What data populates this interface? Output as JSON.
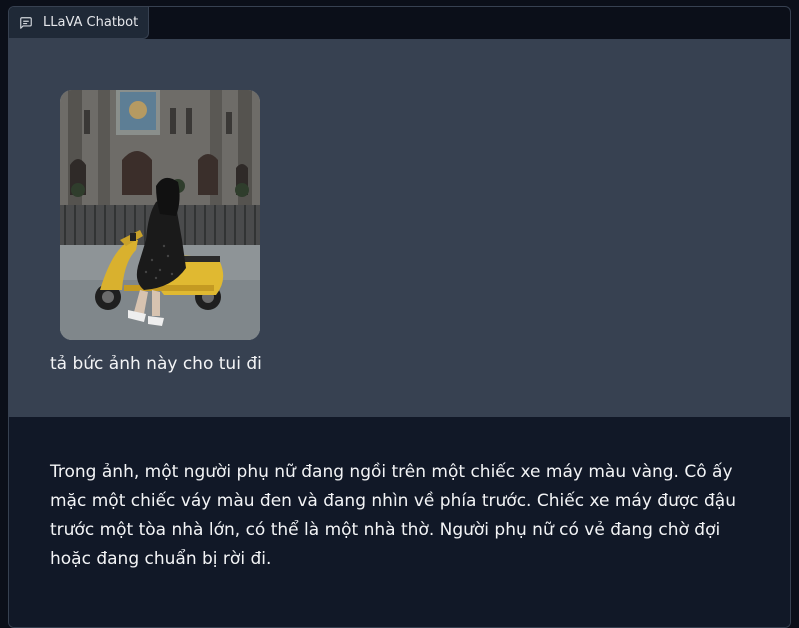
{
  "header": {
    "title": "LLaVA Chatbot",
    "icon": "chat-icon"
  },
  "messages": [
    {
      "role": "user",
      "image": "photo of a woman in a black dress sitting on a yellow scooter in front of a gothic cathedral",
      "text": "tả bức ảnh này cho tui đi"
    },
    {
      "role": "bot",
      "text": "Trong ảnh, một người phụ nữ đang ngồi trên một chiếc xe máy màu vàng. Cô ấy mặc một chiếc váy màu đen và đang nhìn về phía trước. Chiếc xe máy được đậu trước một tòa nhà lớn, có thể là một nhà thờ. Người phụ nữ có vẻ đang chờ đợi hoặc đang chuẩn bị rời đi."
    }
  ],
  "colors": {
    "page_bg": "#0b0f19",
    "user_bubble": "#374151",
    "bot_bubble": "#111827",
    "text": "#f3f4f6"
  }
}
